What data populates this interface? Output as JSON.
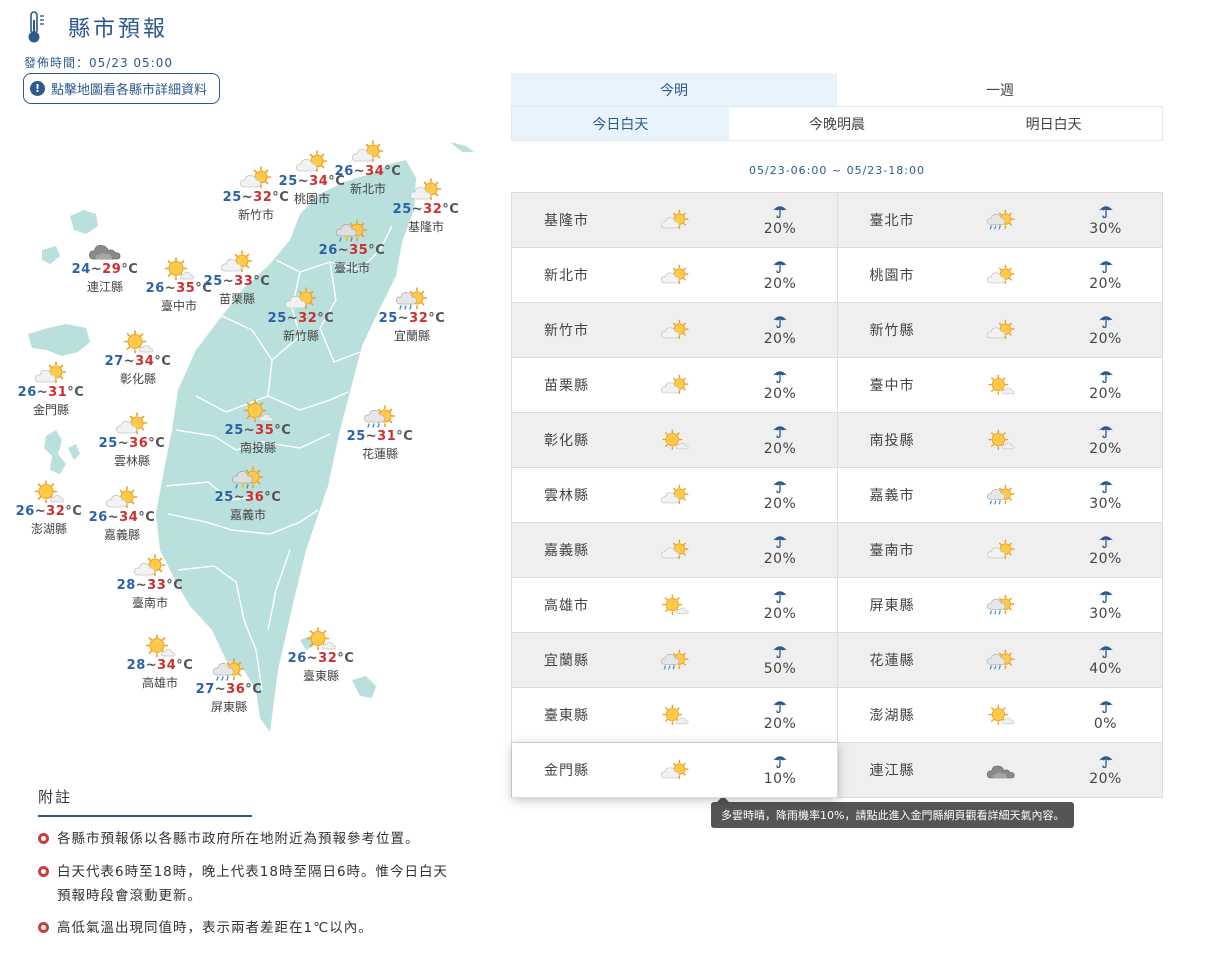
{
  "header": {
    "title": "縣市預報",
    "publish_time": "發佈時間：05/23 05:00",
    "map_tip": "點擊地圖看各縣市詳細資料"
  },
  "tabs": {
    "main": [
      {
        "label": "今明",
        "active": true
      },
      {
        "label": "一週",
        "active": false
      }
    ],
    "sub": [
      {
        "label": "今日白天",
        "active": true
      },
      {
        "label": "今晚明晨",
        "active": false
      },
      {
        "label": "明日白天",
        "active": false
      }
    ]
  },
  "period_range": "05/23-06:00 ~ 05/23-18:00",
  "map_labels": [
    {
      "name": "新竹市",
      "low": "25",
      "high": "32",
      "icon": "partly-cloudy-icon"
    },
    {
      "name": "桃園市",
      "low": "25",
      "high": "34",
      "icon": "partly-cloudy-icon"
    },
    {
      "name": "新北市",
      "low": "26",
      "high": "34",
      "icon": "partly-cloudy-icon"
    },
    {
      "name": "基隆市",
      "low": "25",
      "high": "32",
      "icon": "partly-cloudy-icon"
    },
    {
      "name": "臺北市",
      "low": "26",
      "high": "35",
      "icon": "thunder-rain-icon"
    },
    {
      "name": "連江縣",
      "low": "24",
      "high": "29",
      "icon": "dark-cloud-icon"
    },
    {
      "name": "臺中市",
      "low": "26",
      "high": "35",
      "icon": "sunny-cloud-icon"
    },
    {
      "name": "苗栗縣",
      "low": "25",
      "high": "33",
      "icon": "partly-cloudy-icon"
    },
    {
      "name": "新竹縣",
      "low": "25",
      "high": "32",
      "icon": "partly-cloudy-icon"
    },
    {
      "name": "宜蘭縣",
      "low": "25",
      "high": "32",
      "icon": "rain-cloud-icon"
    },
    {
      "name": "彰化縣",
      "low": "27",
      "high": "34",
      "icon": "sunny-cloud-icon"
    },
    {
      "name": "金門縣",
      "low": "26",
      "high": "31",
      "icon": "partly-cloudy-icon"
    },
    {
      "name": "雲林縣",
      "low": "25",
      "high": "36",
      "icon": "partly-cloudy-icon"
    },
    {
      "name": "南投縣",
      "low": "25",
      "high": "35",
      "icon": "sunny-cloud-icon"
    },
    {
      "name": "花蓮縣",
      "low": "25",
      "high": "31",
      "icon": "rain-cloud-icon"
    },
    {
      "name": "澎湖縣",
      "low": "26",
      "high": "32",
      "icon": "sunny-cloud-icon"
    },
    {
      "name": "嘉義縣",
      "low": "26",
      "high": "34",
      "icon": "partly-cloudy-icon"
    },
    {
      "name": "嘉義市",
      "low": "25",
      "high": "36",
      "icon": "thunder-rain-icon"
    },
    {
      "name": "臺南市",
      "low": "28",
      "high": "33",
      "icon": "partly-cloudy-icon"
    },
    {
      "name": "高雄市",
      "low": "28",
      "high": "34",
      "icon": "sunny-cloud-icon"
    },
    {
      "name": "臺東縣",
      "low": "26",
      "high": "32",
      "icon": "sunny-cloud-icon"
    },
    {
      "name": "屏東縣",
      "low": "27",
      "high": "36",
      "icon": "rain-cloud-icon"
    }
  ],
  "temp_sep": "~",
  "temp_unit": "°C",
  "forecast_rows": [
    [
      {
        "name": "基隆市",
        "icon": "partly-cloudy-icon",
        "rain": "20%"
      },
      {
        "name": "臺北市",
        "icon": "rain-cloud-icon",
        "rain": "30%"
      }
    ],
    [
      {
        "name": "新北市",
        "icon": "partly-cloudy-icon",
        "rain": "20%"
      },
      {
        "name": "桃園市",
        "icon": "partly-cloudy-icon",
        "rain": "20%"
      }
    ],
    [
      {
        "name": "新竹市",
        "icon": "partly-cloudy-icon",
        "rain": "20%"
      },
      {
        "name": "新竹縣",
        "icon": "partly-cloudy-icon",
        "rain": "20%"
      }
    ],
    [
      {
        "name": "苗栗縣",
        "icon": "partly-cloudy-icon",
        "rain": "20%"
      },
      {
        "name": "臺中市",
        "icon": "sunny-cloud-icon",
        "rain": "20%"
      }
    ],
    [
      {
        "name": "彰化縣",
        "icon": "sunny-cloud-icon",
        "rain": "20%"
      },
      {
        "name": "南投縣",
        "icon": "sunny-cloud-icon",
        "rain": "20%"
      }
    ],
    [
      {
        "name": "雲林縣",
        "icon": "partly-cloudy-icon",
        "rain": "20%"
      },
      {
        "name": "嘉義市",
        "icon": "rain-cloud-icon",
        "rain": "30%"
      }
    ],
    [
      {
        "name": "嘉義縣",
        "icon": "partly-cloudy-icon",
        "rain": "20%"
      },
      {
        "name": "臺南市",
        "icon": "partly-cloudy-icon",
        "rain": "20%"
      }
    ],
    [
      {
        "name": "高雄市",
        "icon": "sunny-cloud-icon",
        "rain": "20%"
      },
      {
        "name": "屏東縣",
        "icon": "rain-cloud-icon",
        "rain": "30%"
      }
    ],
    [
      {
        "name": "宜蘭縣",
        "icon": "rain-cloud-icon",
        "rain": "50%"
      },
      {
        "name": "花蓮縣",
        "icon": "rain-cloud-icon",
        "rain": "40%"
      }
    ],
    [
      {
        "name": "臺東縣",
        "icon": "sunny-cloud-icon",
        "rain": "20%"
      },
      {
        "name": "澎湖縣",
        "icon": "sunny-cloud-icon",
        "rain": "0%"
      }
    ],
    [
      {
        "name": "金門縣",
        "icon": "partly-cloudy-icon",
        "rain": "10%"
      },
      {
        "name": "連江縣",
        "icon": "dark-cloud-icon",
        "rain": "20%"
      }
    ]
  ],
  "tooltip": "多雲時晴，降雨機率10%，請點此進入金門縣網頁觀看詳細天氣內容。",
  "notes": {
    "title": "附註",
    "items": [
      "各縣市預報係以各縣市政府所在地附近為預報參考位置。",
      "白天代表6時至18時，晚上代表18時至隔日6時。惟今日白天預報時段會滾動更新。",
      "高低氣溫出現同值時，表示兩者差距在1℃以內。"
    ]
  },
  "colors": {
    "accent": "#2d5a8e",
    "map_land": "#b9e0dc",
    "temp_low": "#2a62a8",
    "temp_high": "#cc3030",
    "tab_active_bg": "#e8f3fc",
    "note_bullet": "#c8403a"
  }
}
